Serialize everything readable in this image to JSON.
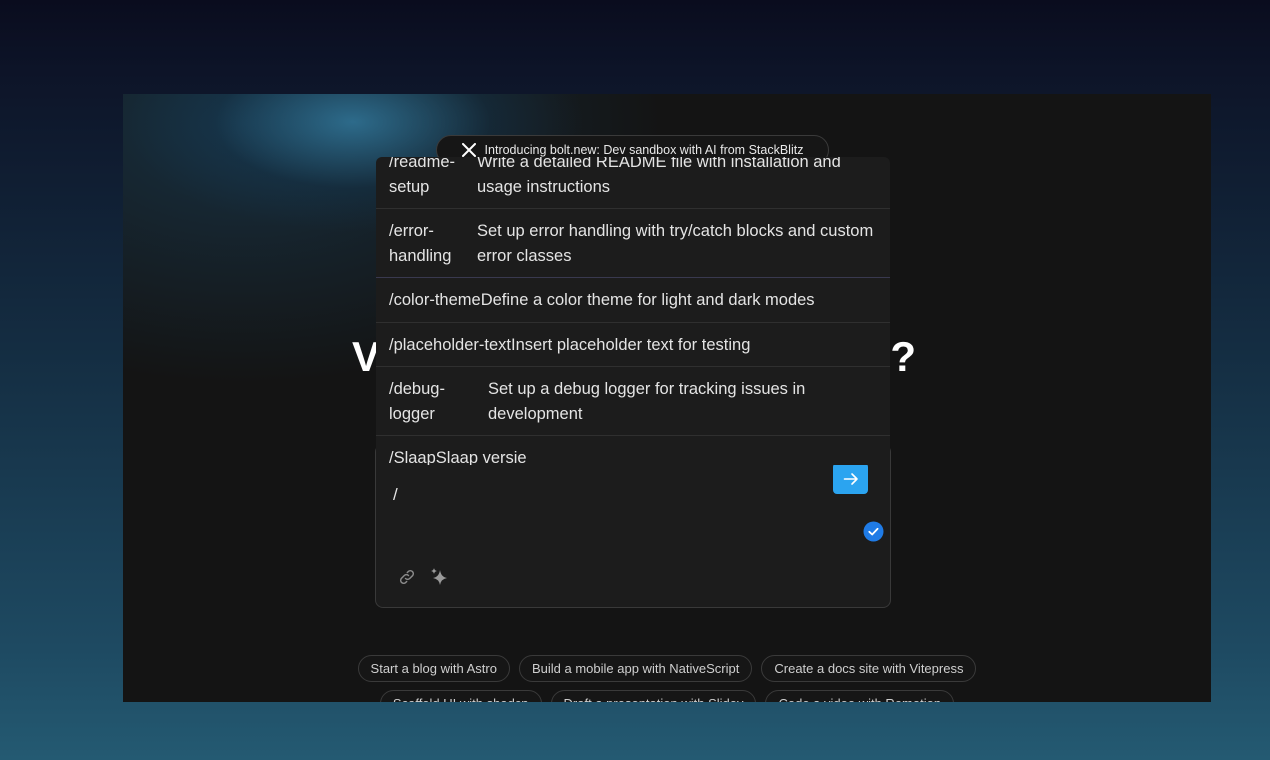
{
  "announcement": {
    "text": "Introducing bolt.new: Dev sandbox with AI from StackBlitz",
    "icon": "x-logo-icon"
  },
  "headline": {
    "visible_start": "V",
    "visible_end": "?"
  },
  "prompt": {
    "value": "/",
    "send_icon": "arrow-right-icon",
    "status_icon": "check-circle-icon",
    "tools": [
      "link-icon",
      "sparkle-icon"
    ]
  },
  "slash_menu": {
    "items": [
      {
        "command": "/readme-setup",
        "description": "Write a detailed README file with installation and usage instructions"
      },
      {
        "command": "/error-handling",
        "description": "Set up error handling with try/catch blocks and custom error classes"
      },
      {
        "command": "/color-theme",
        "description": "Define a color theme for light and dark modes"
      },
      {
        "command": "/placeholder-text",
        "description": "Insert placeholder text for testing"
      },
      {
        "command": "/debug-logger",
        "description": "Set up a debug logger for tracking issues in development"
      },
      {
        "command": "/Slaap",
        "description": "Slaap versie"
      }
    ]
  },
  "suggestions": {
    "row1": [
      "Start a blog with Astro",
      "Build a mobile app with NativeScript",
      "Create a docs site with Vitepress"
    ],
    "row2": [
      "Scaffold UI with shadcn",
      "Draft a presentation with Slidev",
      "Code a video with Remotion"
    ]
  },
  "colors": {
    "accent": "#2ba4f0",
    "check": "#1f7be6",
    "background": "#141414"
  }
}
